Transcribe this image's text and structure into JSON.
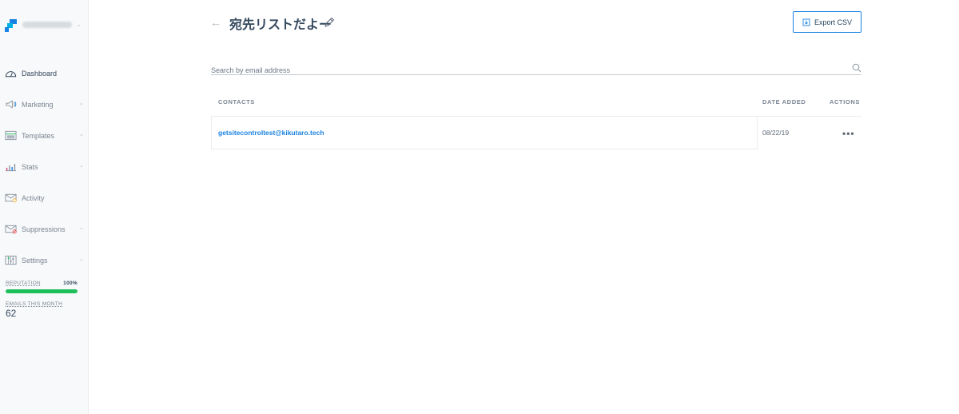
{
  "sidebar": {
    "items": [
      {
        "label": "Dashboard",
        "icon": "dashboard-icon",
        "active": true,
        "chevron": false
      },
      {
        "label": "Marketing",
        "icon": "megaphone-icon",
        "active": false,
        "chevron": true
      },
      {
        "label": "Templates",
        "icon": "templates-icon",
        "active": false,
        "chevron": true
      },
      {
        "label": "Stats",
        "icon": "stats-icon",
        "active": false,
        "chevron": true
      },
      {
        "label": "Activity",
        "icon": "activity-icon",
        "active": false,
        "chevron": false
      },
      {
        "label": "Suppressions",
        "icon": "suppressions-icon",
        "active": false,
        "chevron": true
      },
      {
        "label": "Settings",
        "icon": "settings-icon",
        "active": false,
        "chevron": true
      }
    ],
    "reputation_label": "REPUTATION",
    "reputation_value": "100%",
    "reputation_fraction": 1.0,
    "emails_label": "EMAILS THIS MONTH",
    "emails_value": "62"
  },
  "header": {
    "title": "宛先リストだよー",
    "export_label": "Export CSV"
  },
  "search": {
    "placeholder": "Search by email address"
  },
  "table": {
    "columns": {
      "contacts": "CONTACTS",
      "date_added": "DATE ADDED",
      "actions": "ACTIONS"
    },
    "rows": [
      {
        "email": "getsitecontroltest@kikutaro.tech",
        "date": "08/22/19",
        "actions": "•••"
      }
    ]
  },
  "colors": {
    "accent": "#1a82e2",
    "reputation": "#1fbf5c",
    "text": "#34495e"
  }
}
